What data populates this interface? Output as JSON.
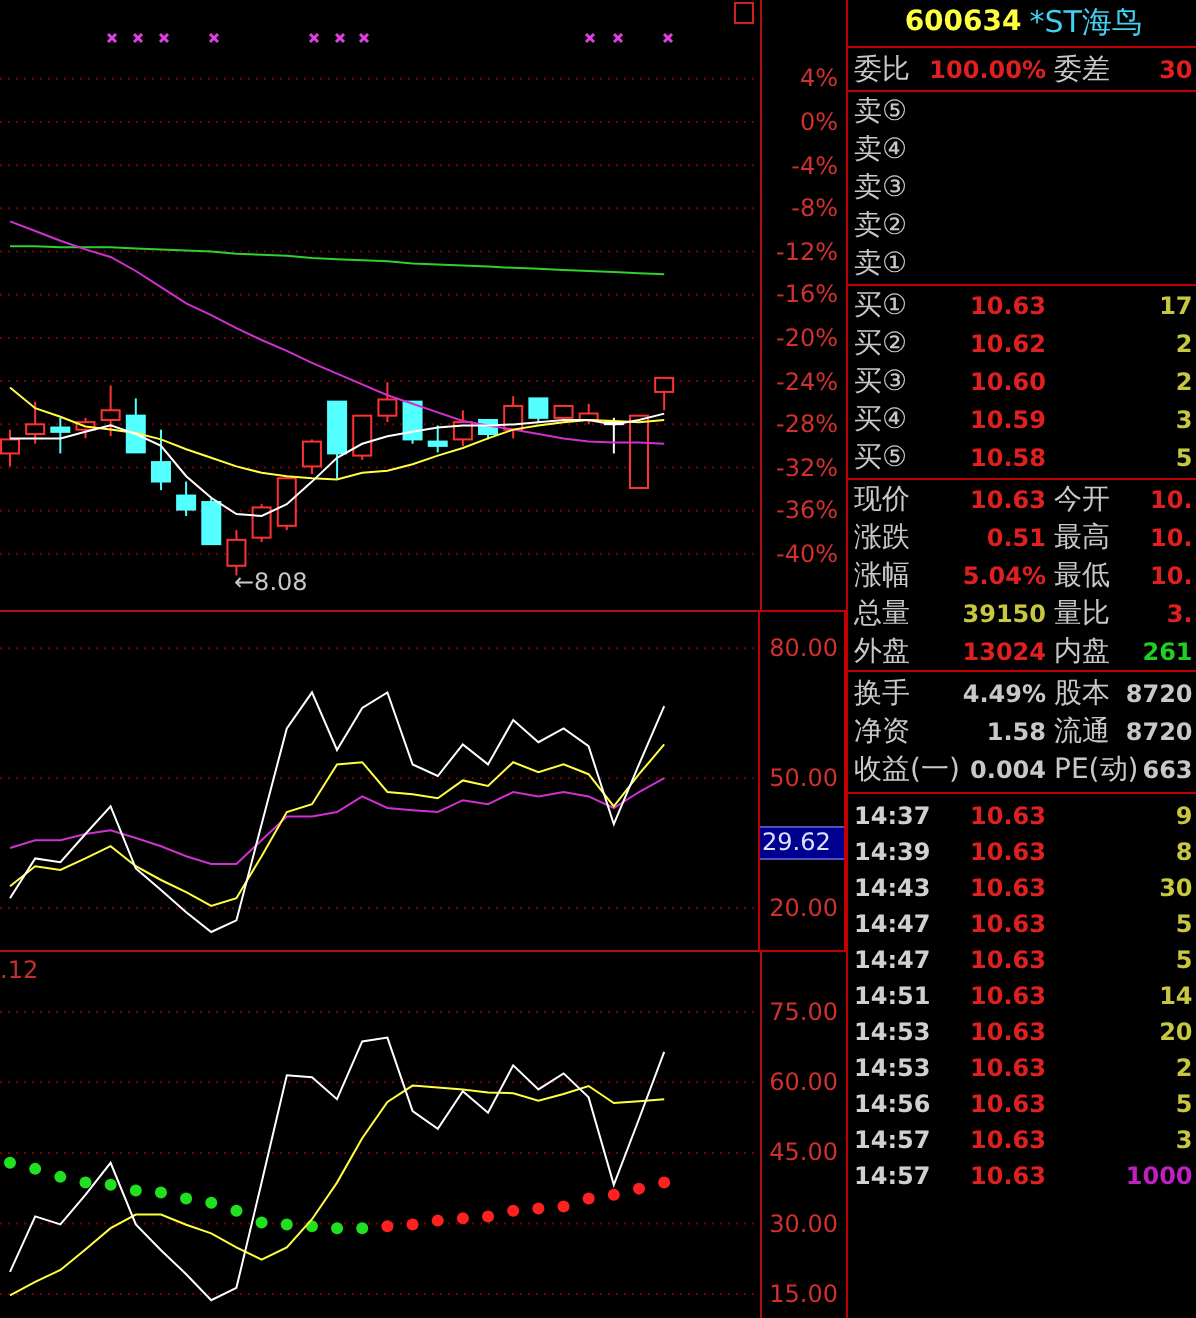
{
  "chart": {
    "low_label": "←8.08",
    "lower_value": ".12"
  },
  "price_chart": {
    "chart_data": {
      "type": "candlestick",
      "ylim": [
        -45.2,
        11.3
      ],
      "grid": true,
      "ohlc": [
        [
          -30.7,
          -28.5,
          -31.9,
          -29.4
        ],
        [
          -28.9,
          -25.9,
          -29.8,
          -28.0
        ],
        [
          -28.3,
          -27.4,
          -30.7,
          -28.7
        ],
        [
          -28.5,
          -27.4,
          -29.3,
          -27.8
        ],
        [
          -27.6,
          -24.4,
          -29.1,
          -26.7
        ],
        [
          -27.2,
          -25.6,
          -30.6,
          -30.6
        ],
        [
          -31.5,
          -28.5,
          -34.1,
          -33.3
        ],
        [
          -34.6,
          -33.3,
          -36.5,
          -35.9
        ],
        [
          -35.2,
          -34.8,
          -39.1,
          -39.1
        ],
        [
          -41.1,
          -37.8,
          -42.0,
          -38.7
        ],
        [
          -38.5,
          -35.4,
          -38.9,
          -35.7
        ],
        [
          -37.4,
          -32.8,
          -37.8,
          -33.0
        ],
        [
          -31.9,
          -29.4,
          -32.6,
          -29.6
        ],
        [
          -25.9,
          -25.9,
          -33.1,
          -30.7
        ],
        [
          -30.9,
          -27.2,
          -31.3,
          -27.2
        ],
        [
          -27.2,
          -24.1,
          -27.8,
          -25.7
        ],
        [
          -25.9,
          -25.9,
          -29.8,
          -29.4
        ],
        [
          -29.6,
          -28.1,
          -30.6,
          -30.0
        ],
        [
          -29.4,
          -26.7,
          -30.0,
          -27.8
        ],
        [
          -27.6,
          -27.6,
          -29.4,
          -28.9
        ],
        [
          -28.5,
          -25.4,
          -29.3,
          -26.3
        ],
        [
          -25.6,
          -25.6,
          -27.8,
          -27.4
        ],
        [
          -27.4,
          -26.3,
          -27.8,
          -26.3
        ],
        [
          -27.6,
          -26.1,
          -28.0,
          -27.0
        ],
        [
          -27.8,
          -27.4,
          -30.7,
          -27.8
        ],
        [
          -33.9,
          -27.2,
          -33.9,
          -27.2
        ],
        [
          -25.0,
          -23.7,
          -26.7,
          -23.7
        ]
      ],
      "yticks": [
        {
          "value": 4,
          "label": "4%"
        },
        {
          "value": 0,
          "label": "0%"
        },
        {
          "value": -4,
          "label": "-4%"
        },
        {
          "value": -8,
          "label": "-8%"
        },
        {
          "value": -12,
          "label": "-12%"
        },
        {
          "value": -16,
          "label": "-16%"
        },
        {
          "value": -20,
          "label": "-20%"
        },
        {
          "value": -24,
          "label": "-24%"
        },
        {
          "value": -28,
          "label": "-28%"
        },
        {
          "value": -32,
          "label": "-32%"
        },
        {
          "value": -36,
          "label": "-36%"
        },
        {
          "value": -40,
          "label": "-40%"
        }
      ],
      "series": [
        {
          "type": "line",
          "color": "#30d030",
          "values": [
            -11.5,
            -11.5,
            -11.6,
            -11.6,
            -11.6,
            -11.7,
            -11.8,
            -11.9,
            -12.0,
            -12.2,
            -12.3,
            -12.4,
            -12.6,
            -12.7,
            -12.8,
            -12.9,
            -13.1,
            -13.2,
            -13.3,
            -13.4,
            -13.5,
            -13.6,
            -13.7,
            -13.8,
            -13.9,
            -14.0,
            -14.1
          ]
        },
        {
          "type": "line",
          "color": "#d030d0",
          "values": [
            -9.2,
            -10.1,
            -11.0,
            -11.8,
            -12.5,
            -13.8,
            -15.3,
            -16.8,
            -17.9,
            -19.1,
            -20.2,
            -21.2,
            -22.3,
            -23.3,
            -24.3,
            -25.3,
            -26.1,
            -26.9,
            -27.7,
            -28.1,
            -28.5,
            -28.9,
            -29.3,
            -29.6,
            -29.7,
            -29.7,
            -29.8
          ]
        },
        {
          "type": "line",
          "color": "#ffff40",
          "values": [
            -24.6,
            -26.5,
            -27.3,
            -28.2,
            -28.5,
            -28.8,
            -29.4,
            -30.3,
            -31.1,
            -31.9,
            -32.5,
            -32.8,
            -33.0,
            -33.1,
            -32.5,
            -32.3,
            -31.7,
            -30.9,
            -30.2,
            -29.3,
            -28.5,
            -28.1,
            -27.8,
            -27.6,
            -27.7,
            -27.8,
            -27.6
          ]
        },
        {
          "type": "line",
          "color": "#ffffff",
          "values": [
            -29.3,
            -29.3,
            -29.3,
            -28.7,
            -28.1,
            -28.9,
            -30.0,
            -32.8,
            -34.8,
            -36.3,
            -36.5,
            -35.4,
            -33.3,
            -31.1,
            -29.8,
            -29.1,
            -28.7,
            -28.3,
            -28.1,
            -28.1,
            -28.0,
            -27.8,
            -27.6,
            -27.6,
            -28.0,
            -27.6,
            -27.0
          ]
        }
      ]
    }
  },
  "indicator_chart": {
    "chart_data": {
      "type": "line",
      "ylim": [
        9.9,
        88.8
      ],
      "grid": true,
      "yticks": [
        {
          "value": 80,
          "label": "80.00"
        },
        {
          "value": 50,
          "label": "50.00"
        },
        {
          "value": 20,
          "label": "20.00"
        }
      ],
      "series": [
        {
          "color": "#d030d0",
          "values": [
            33.9,
            35.7,
            35.7,
            37.1,
            38.0,
            36.2,
            34.3,
            32.0,
            30.2,
            30.2,
            35.7,
            41.2,
            41.2,
            42.2,
            45.8,
            43.1,
            42.6,
            42.2,
            44.9,
            44.0,
            46.8,
            45.8,
            46.8,
            45.8,
            43.1,
            46.8,
            50.0
          ]
        },
        {
          "color": "#ffff40",
          "values": [
            25.1,
            29.7,
            28.8,
            31.5,
            34.3,
            29.7,
            26.5,
            23.7,
            20.5,
            22.3,
            32.0,
            42.2,
            44.0,
            53.2,
            53.7,
            46.8,
            46.3,
            45.4,
            49.5,
            48.2,
            53.7,
            51.4,
            53.2,
            50.9,
            43.5,
            50.9,
            57.8
          ]
        },
        {
          "color": "#ffffff",
          "values": [
            22.3,
            31.5,
            30.6,
            37.1,
            43.5,
            29.2,
            24.2,
            19.1,
            14.5,
            17.2,
            39.4,
            61.5,
            69.8,
            56.5,
            66.2,
            69.8,
            53.2,
            50.5,
            57.8,
            53.2,
            63.4,
            58.3,
            61.5,
            57.4,
            39.4,
            53.2,
            66.6
          ]
        }
      ]
    },
    "reading": "29.62"
  },
  "oscillator_chart": {
    "chart_data": {
      "type": "line",
      "ylim": [
        9.9,
        87.7
      ],
      "grid": true,
      "yticks": [
        {
          "value": 75,
          "label": "75.00"
        },
        {
          "value": 60,
          "label": "60.00"
        },
        {
          "value": 45,
          "label": "45.00"
        },
        {
          "value": 30,
          "label": "30.00"
        },
        {
          "value": 15,
          "label": "15.00"
        }
      ],
      "series": [
        {
          "type": "scatter",
          "color": "#20e020",
          "values": [
            42.9,
            41.6,
            39.9,
            38.7,
            38.2,
            37.0,
            36.6,
            35.3,
            34.4,
            32.7,
            30.2,
            29.8,
            29.4,
            29.0,
            29.0,
            null,
            null,
            null,
            null,
            null,
            null,
            null,
            null,
            null,
            null,
            null,
            null
          ]
        },
        {
          "type": "scatter",
          "color": "#ff2020",
          "values": [
            null,
            null,
            null,
            null,
            null,
            null,
            null,
            null,
            null,
            null,
            null,
            null,
            null,
            null,
            null,
            29.4,
            29.8,
            30.6,
            31.1,
            31.5,
            32.7,
            33.2,
            33.6,
            35.3,
            36.1,
            37.4,
            38.7
          ]
        },
        {
          "type": "line",
          "color": "#ffff40",
          "values": [
            14.7,
            17.6,
            20.1,
            24.5,
            29.0,
            31.9,
            31.9,
            29.7,
            27.9,
            24.9,
            22.3,
            24.9,
            30.9,
            38.7,
            48.1,
            55.8,
            59.3,
            58.9,
            58.5,
            57.8,
            57.7,
            56.1,
            57.5,
            59.2,
            55.6,
            56.0,
            56.4
          ]
        },
        {
          "type": "line",
          "color": "#ffffff",
          "values": [
            19.7,
            31.5,
            29.8,
            36.1,
            42.9,
            29.8,
            24.3,
            19.2,
            13.7,
            16.3,
            38.7,
            61.5,
            61.1,
            56.4,
            68.7,
            69.5,
            53.9,
            50.1,
            58.1,
            53.5,
            63.6,
            58.5,
            61.9,
            56.8,
            38.2,
            52.2,
            66.5
          ]
        }
      ]
    }
  },
  "stock": {
    "code": "600634",
    "name": "*ST海鸟"
  },
  "order_ratio": {
    "label": "委比",
    "value": "100.00%",
    "diff_label": "委差",
    "diff": "30"
  },
  "sell_levels": [
    {
      "label": "卖⑤"
    },
    {
      "label": "卖④"
    },
    {
      "label": "卖③"
    },
    {
      "label": "卖②"
    },
    {
      "label": "卖①"
    }
  ],
  "buy_levels": [
    {
      "label": "买①",
      "price": "10.63",
      "volume": "17"
    },
    {
      "label": "买②",
      "price": "10.62",
      "volume": "2"
    },
    {
      "label": "买③",
      "price": "10.60",
      "volume": "2"
    },
    {
      "label": "买④",
      "price": "10.59",
      "volume": "3"
    },
    {
      "label": "买⑤",
      "price": "10.58",
      "volume": "5"
    }
  ],
  "quote": [
    {
      "label": "现价",
      "value": "10.63",
      "label2": "今开",
      "value2": "10."
    },
    {
      "label": "涨跌",
      "value": "0.51",
      "label2": "最高",
      "value2": "10."
    },
    {
      "label": "涨幅",
      "value": "5.04%",
      "label2": "最低",
      "value2": "10."
    },
    {
      "label": "总量",
      "value": "39150",
      "label2": "量比",
      "value2": "3."
    },
    {
      "label": "外盘",
      "value": "13024",
      "label2": "内盘",
      "value2": "261"
    }
  ],
  "fundamentals": [
    {
      "label": "换手",
      "value": "4.49%",
      "label2": "股本",
      "value2": "8720"
    },
    {
      "label": "净资",
      "value": "1.58",
      "label2": "流通",
      "value2": "8720"
    },
    {
      "label": "收益(一)",
      "value": "0.004",
      "label2": "PE(动)",
      "value2": "663"
    }
  ],
  "trades": [
    {
      "time": "14:37",
      "price": "10.63",
      "volume": "9",
      "color": "#c8c840"
    },
    {
      "time": "14:39",
      "price": "10.63",
      "volume": "8",
      "color": "#c8c840"
    },
    {
      "time": "14:43",
      "price": "10.63",
      "volume": "30",
      "color": "#c8c840"
    },
    {
      "time": "14:47",
      "price": "10.63",
      "volume": "5",
      "color": "#c8c840"
    },
    {
      "time": "14:47",
      "price": "10.63",
      "volume": "5",
      "color": "#c8c840"
    },
    {
      "time": "14:51",
      "price": "10.63",
      "volume": "14",
      "color": "#c8c840"
    },
    {
      "time": "14:53",
      "price": "10.63",
      "volume": "20",
      "color": "#c8c840"
    },
    {
      "time": "14:53",
      "price": "10.63",
      "volume": "2",
      "color": "#c8c840"
    },
    {
      "time": "14:56",
      "price": "10.63",
      "volume": "5",
      "color": "#c8c840"
    },
    {
      "time": "14:57",
      "price": "10.63",
      "volume": "3",
      "color": "#c8c840"
    },
    {
      "time": "14:57",
      "price": "10.63",
      "volume": "1000",
      "color": "#c020c0"
    }
  ]
}
